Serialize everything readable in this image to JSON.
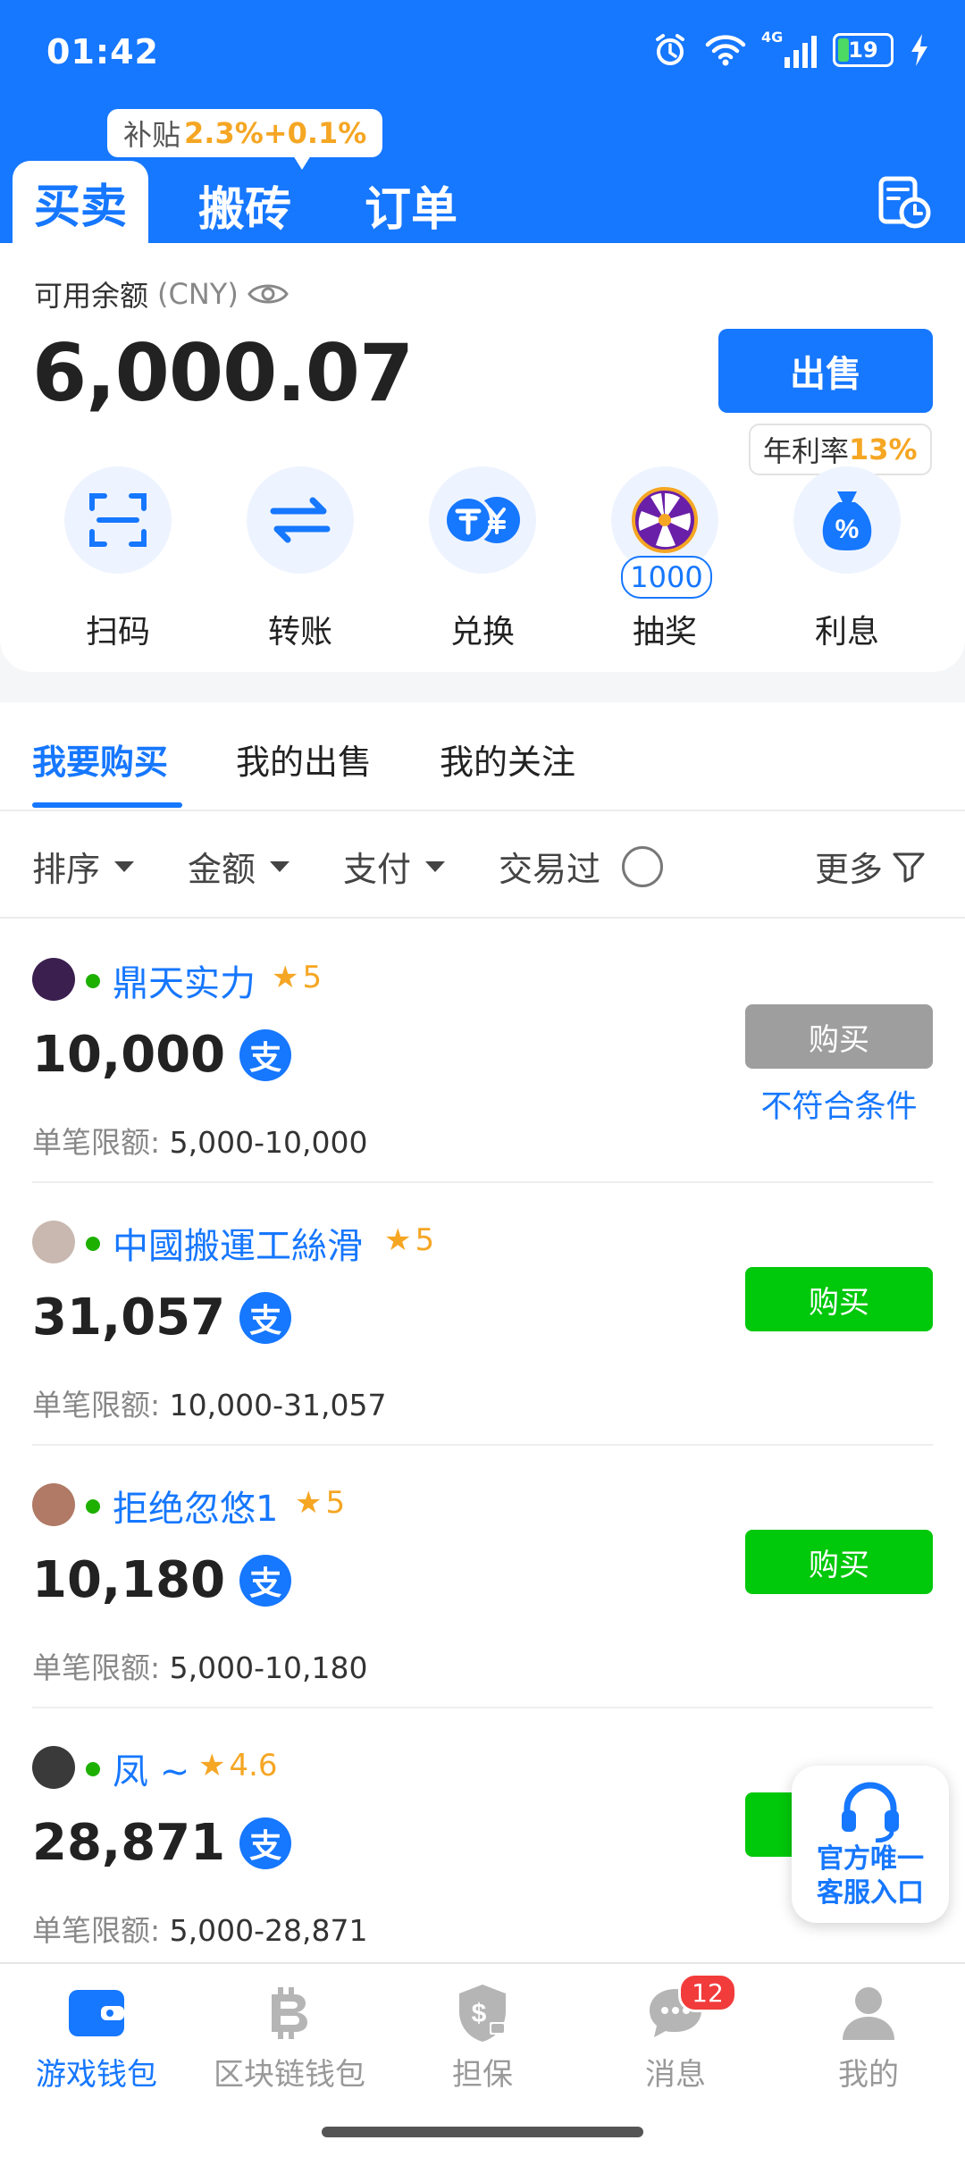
{
  "status_bar": {
    "time": "01:42",
    "network": "4G",
    "battery": "19"
  },
  "top_tabs": [
    {
      "label": "买卖"
    },
    {
      "label": "搬砖"
    },
    {
      "label": "订单"
    }
  ],
  "subsidy": {
    "prefix": "补贴",
    "value": "2.3%+0.1%"
  },
  "balance": {
    "label": "可用余额",
    "currency": "(CNY)",
    "value": "6,000.07"
  },
  "sell_button": "出售",
  "rate_bubble": {
    "prefix": "年利率",
    "value": "13%"
  },
  "quick_actions": [
    {
      "label": "扫码",
      "icon": "scan-icon"
    },
    {
      "label": "转账",
      "icon": "transfer-icon"
    },
    {
      "label": "兑换",
      "icon": "exchange-icon"
    },
    {
      "label": "抽奖",
      "icon": "lottery-wheel-icon",
      "badge": "1000"
    },
    {
      "label": "利息",
      "icon": "interest-bag-icon"
    }
  ],
  "sub_tabs": [
    {
      "label": "我要购买"
    },
    {
      "label": "我的出售"
    },
    {
      "label": "我的关注"
    }
  ],
  "filters": {
    "sort": "排序",
    "amount": "金额",
    "payment": "支付",
    "traded": "交易过",
    "more": "更多"
  },
  "limit_label": "单笔限额:",
  "pay_glyph": "支",
  "listings": [
    {
      "name": "鼎天实力",
      "rating": "5",
      "amount": "10,000",
      "limit": "5,000-10,000",
      "button": "购买",
      "status": "不符合条件",
      "avatar_color": "#3b1f4f"
    },
    {
      "name": "中國搬運工絲滑",
      "rating": "5",
      "amount": "31,057",
      "limit": "10,000-31,057",
      "button": "购买",
      "status": "",
      "avatar_color": "#c9b8b0"
    },
    {
      "name": "拒绝忽悠1",
      "rating": "5",
      "amount": "10,180",
      "limit": "5,000-10,180",
      "button": "购买",
      "status": "",
      "avatar_color": "#b07a66"
    },
    {
      "name": "凤 ~",
      "rating": "4.6",
      "amount": "28,871",
      "limit": "5,000-28,871",
      "button": "购买",
      "status": "",
      "avatar_color": "#3a3a3a"
    }
  ],
  "support": {
    "line1": "官方唯一",
    "line2": "客服入口"
  },
  "bottom_nav": [
    {
      "label": "游戏钱包",
      "icon": "wallet-icon"
    },
    {
      "label": "区块链钱包",
      "icon": "bitcoin-icon"
    },
    {
      "label": "担保",
      "icon": "shield-dollar-icon"
    },
    {
      "label": "消息",
      "icon": "chat-bubble-icon",
      "badge": "12"
    },
    {
      "label": "我的",
      "icon": "person-icon"
    }
  ],
  "colors": {
    "primary": "#1677ff",
    "buy_green": "#00c80a",
    "disabled_gray": "#9e9e9e",
    "accent_orange": "#f5a623"
  }
}
